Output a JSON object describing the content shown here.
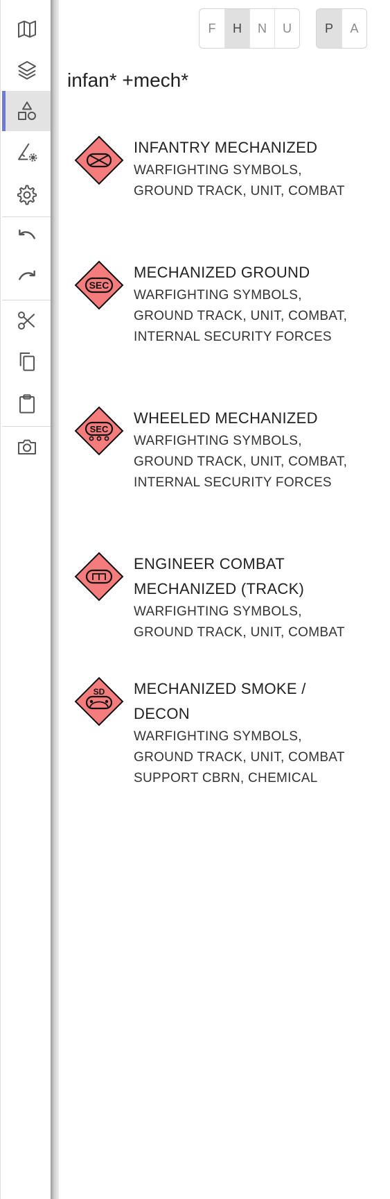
{
  "toolbar": {
    "items": [
      {
        "icon": "map-icon"
      },
      {
        "icon": "layers-icon"
      },
      {
        "icon": "shapes-icon",
        "active": true
      },
      {
        "icon": "draw-settings-icon"
      },
      {
        "icon": "gear-icon"
      },
      {
        "icon": "undo-icon"
      },
      {
        "icon": "redo-icon"
      },
      {
        "icon": "scissors-icon"
      },
      {
        "icon": "copy-icon"
      },
      {
        "icon": "clipboard-icon"
      },
      {
        "icon": "camera-icon"
      }
    ],
    "active_color": "#6f7bd0"
  },
  "affiliation_filter": {
    "buttons": [
      "F",
      "H",
      "N",
      "U"
    ],
    "selected": "H"
  },
  "status_filter": {
    "buttons": [
      "P",
      "A"
    ],
    "selected": "P"
  },
  "search": {
    "query": "infan* +mech*"
  },
  "symbol_fill_color": "#f47c7c",
  "results": [
    {
      "title_lines": [
        "INFANTRY MECHANIZED"
      ],
      "sub_lines": [
        "WARFIGHTING SYMBOLS,",
        "GROUND TRACK, UNIT, COMBAT"
      ],
      "icon": "hostile-infantry-mechanized-symbol"
    },
    {
      "title_lines": [
        "MECHANIZED GROUND"
      ],
      "sub_lines": [
        "WARFIGHTING SYMBOLS,",
        "GROUND TRACK, UNIT, COMBAT,",
        "INTERNAL SECURITY FORCES"
      ],
      "icon": "hostile-security-mechanized-symbol",
      "symbol_text": "SEC"
    },
    {
      "title_lines": [
        "WHEELED MECHANIZED"
      ],
      "sub_lines": [
        "WARFIGHTING SYMBOLS,",
        "GROUND TRACK, UNIT, COMBAT,",
        "INTERNAL SECURITY FORCES"
      ],
      "icon": "hostile-security-wheeled-symbol",
      "symbol_text": "SEC"
    },
    {
      "title_lines": [
        "ENGINEER COMBAT",
        "MECHANIZED (TRACK)"
      ],
      "sub_lines": [
        "WARFIGHTING SYMBOLS,",
        "GROUND TRACK, UNIT, COMBAT"
      ],
      "icon": "hostile-engineer-mechanized-symbol"
    },
    {
      "title_lines": [
        "MECHANIZED SMOKE /",
        "DECON"
      ],
      "sub_lines": [
        "WARFIGHTING SYMBOLS,",
        "GROUND TRACK, UNIT, COMBAT",
        "SUPPORT CBRN, CHEMICAL"
      ],
      "icon": "hostile-smoke-decon-symbol",
      "symbol_text": "SD"
    }
  ]
}
